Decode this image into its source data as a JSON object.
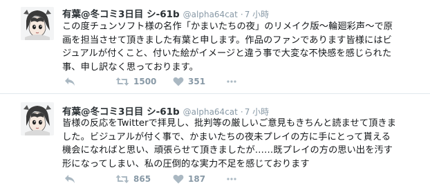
{
  "tweets": [
    {
      "display_name": "有葉@冬コミ3日目 シ-61b",
      "handle": "@alpha64cat",
      "separator": "·",
      "time": "7 小時",
      "lines": [
        "この度チュンソフト様の名作「かまいたちの夜」のリメイク版〜輪廻彩声〜で原",
        "画を担当させて頂きました有葉と申します。作品のファンであります皆様にはビ",
        "ジュアルが付くこと、付いた絵がイメージと違う事で大変な不快感を感じられた",
        "事、申し訳なく思っております。"
      ],
      "retweets": "1500",
      "likes": "351",
      "avatar_icon": "anime-character-avatar"
    },
    {
      "display_name": "有葉@冬コミ3日目 シ-61b",
      "handle": "@alpha64cat",
      "separator": "·",
      "time": "7 小時",
      "lines": [
        "皆様の反応をTwitterで拝見し、批判等の厳しいご意見もきちんと読ませて頂きま",
        "した。ビジュアルが付く事で、かまいたちの夜未プレイの方に手にとって貰える",
        "機会になればと思い、頑張らせて頂きましたが……既プレイの方の思い出を汚す",
        "形になってしまい、私の圧倒的な実力不足を感じております"
      ],
      "retweets": "865",
      "likes": "187",
      "avatar_icon": "anime-character-avatar"
    }
  ],
  "icons": {
    "reply": "reply-icon",
    "retweet": "retweet-icon",
    "like": "heart-icon",
    "more": "more-dots-icon"
  },
  "colors": {
    "text": "#14171a",
    "secondary": "#8899a6",
    "icon": "#aab8c2",
    "divider": "#e1e8ed"
  }
}
